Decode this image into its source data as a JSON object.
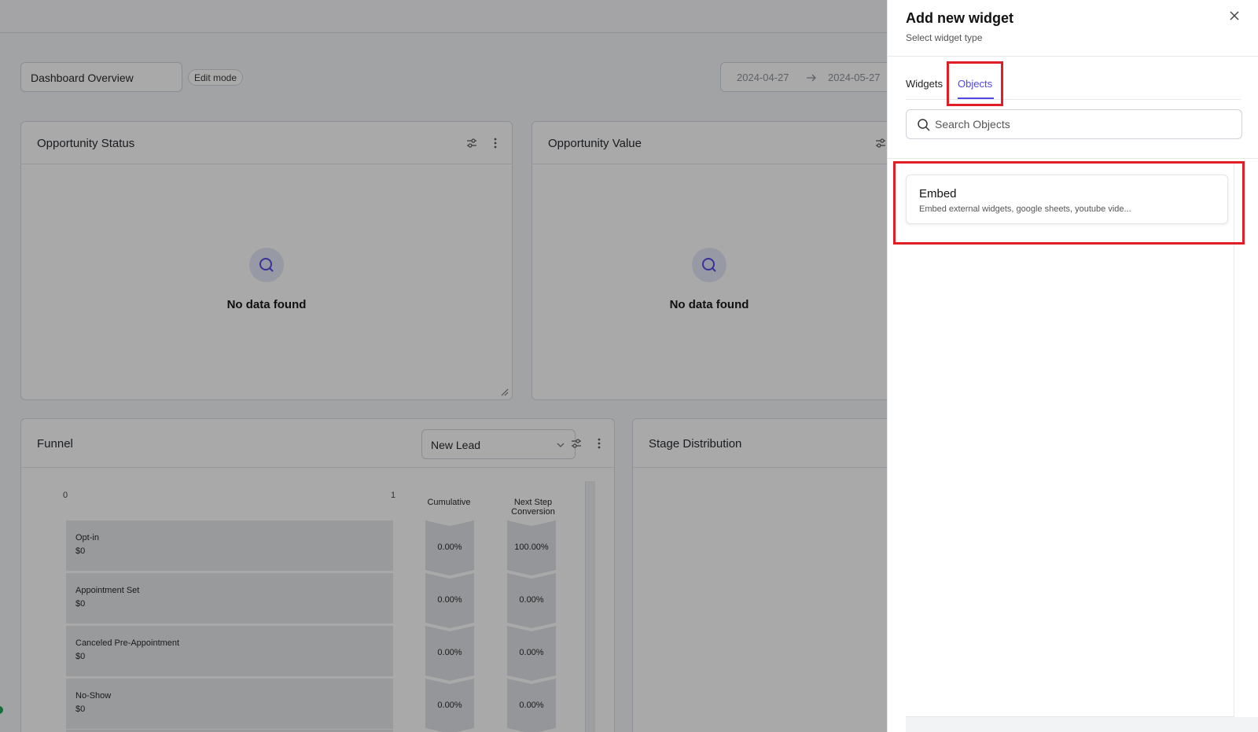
{
  "dashboard": {
    "name": "Dashboard Overview",
    "edit_mode_label": "Edit mode",
    "date_from": "2024-04-27",
    "date_to": "2024-05-27"
  },
  "cards": {
    "opportunity_status": {
      "title": "Opportunity Status",
      "empty_text": "No data found"
    },
    "opportunity_value": {
      "title": "Opportunity Value",
      "empty_text": "No data found"
    },
    "funnel": {
      "title": "Funnel",
      "select_value": "New Lead",
      "axis_min": "0",
      "axis_max": "1",
      "col_cumulative": "Cumulative",
      "col_next_step_1": "Next Step",
      "col_next_step_2": "Conversion",
      "stages": [
        {
          "name": "Opt-in",
          "value": "$0",
          "cumulative": "0.00%",
          "next": "100.00%"
        },
        {
          "name": "Appointment Set",
          "value": "$0",
          "cumulative": "0.00%",
          "next": "0.00%"
        },
        {
          "name": "Canceled Pre-Appointment",
          "value": "$0",
          "cumulative": "0.00%",
          "next": "0.00%"
        },
        {
          "name": "No-Show",
          "value": "$0",
          "cumulative": "0.00%",
          "next": "0.00%"
        }
      ]
    },
    "stage_distribution": {
      "title": "Stage Distribution"
    }
  },
  "drawer": {
    "title": "Add new widget",
    "subtitle": "Select widget type",
    "tabs": [
      {
        "label": "Widgets",
        "active": false
      },
      {
        "label": "Objects",
        "active": true
      }
    ],
    "search_placeholder": "Search Objects",
    "objects": [
      {
        "title": "Embed",
        "description": "Embed external widgets, google sheets, youtube vide..."
      }
    ]
  },
  "colors": {
    "accent": "#4f46e5",
    "highlight": "#e11d25"
  },
  "icons": [
    "search-icon",
    "close-icon",
    "filter-icon",
    "kebab-icon",
    "chevron-down-icon",
    "arrow-right-icon",
    "resize-handle-icon"
  ]
}
